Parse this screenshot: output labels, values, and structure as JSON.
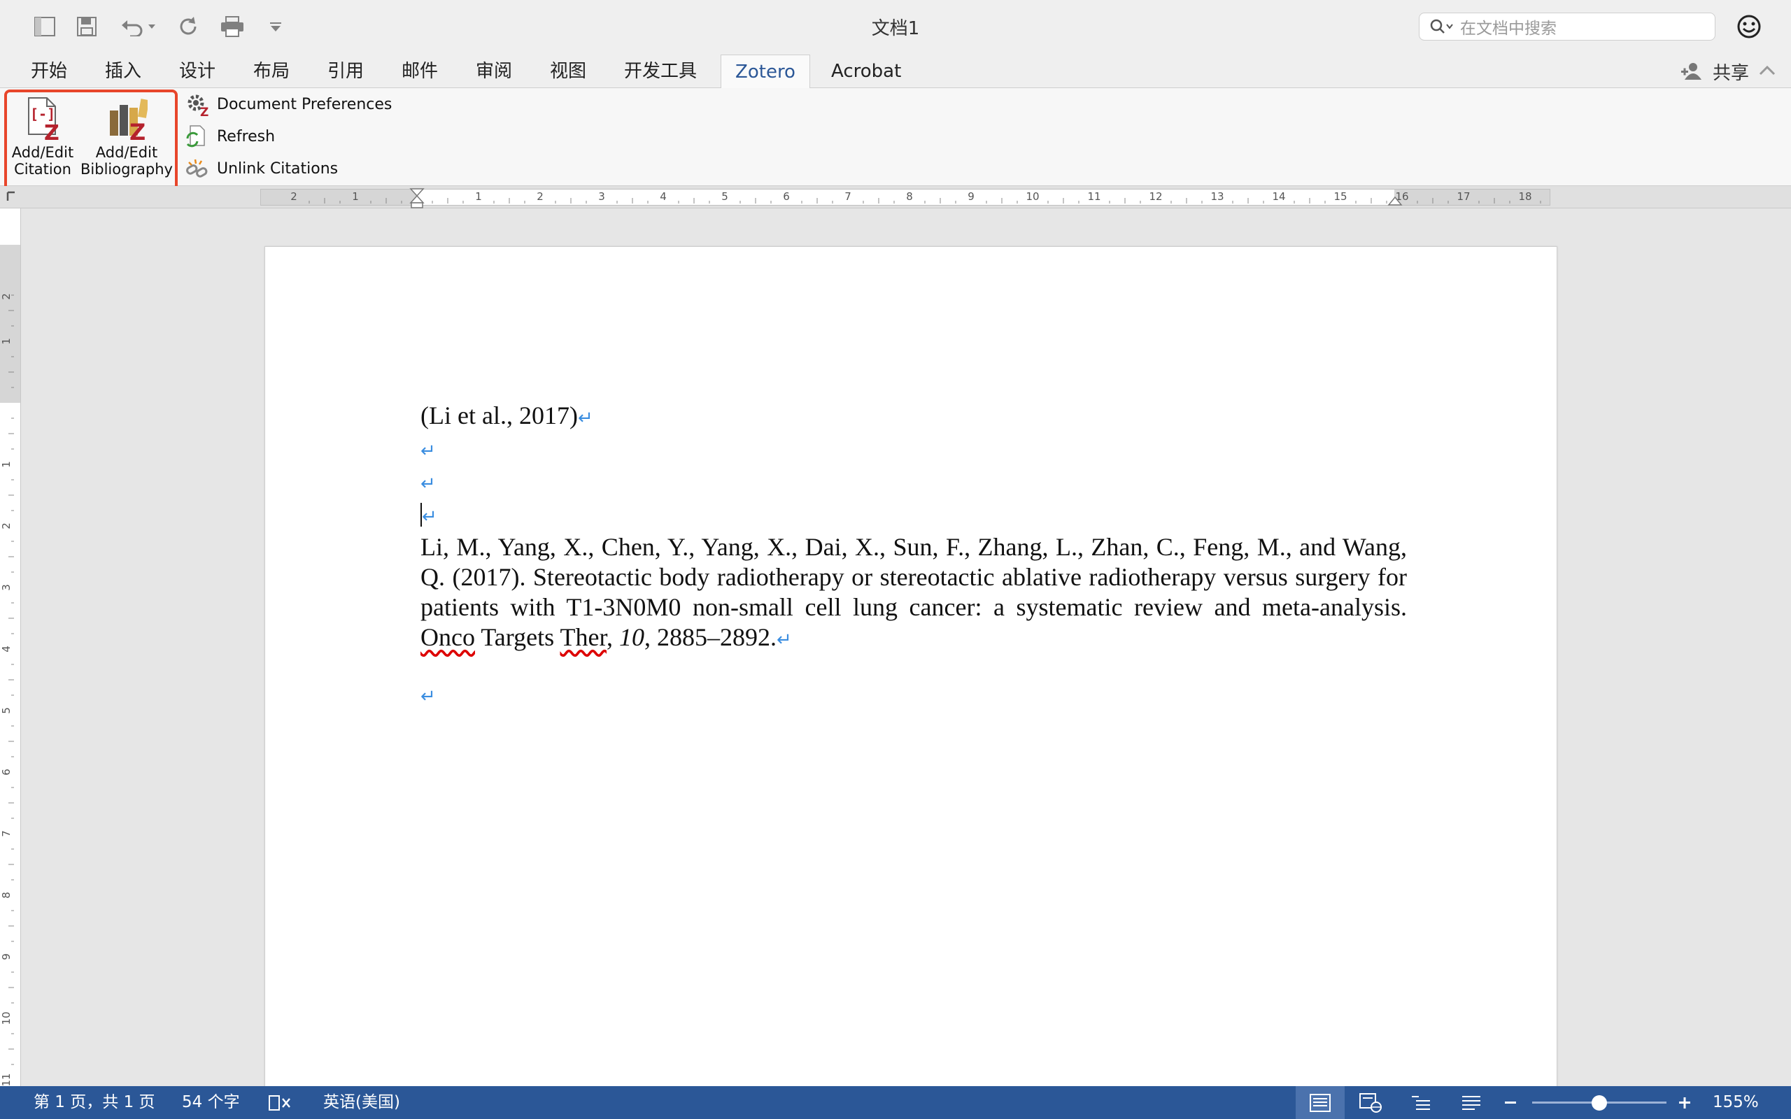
{
  "window": {
    "title": "文档1"
  },
  "quick_access": {
    "icons": [
      "sidebar-icon",
      "save-icon",
      "undo-icon",
      "redo-icon",
      "print-icon",
      "customize-icon"
    ]
  },
  "search": {
    "placeholder": "在文档中搜索"
  },
  "tabs": [
    {
      "label": "开始"
    },
    {
      "label": "插入"
    },
    {
      "label": "设计"
    },
    {
      "label": "布局"
    },
    {
      "label": "引用"
    },
    {
      "label": "邮件"
    },
    {
      "label": "审阅"
    },
    {
      "label": "视图"
    },
    {
      "label": "开发工具"
    },
    {
      "label": "Zotero",
      "active": true
    },
    {
      "label": "Acrobat"
    }
  ],
  "share": {
    "label": "共享"
  },
  "ribbon": {
    "add_citation": {
      "line1": "Add/Edit",
      "line2": "Citation"
    },
    "add_bibliography": {
      "line1": "Add/Edit",
      "line2": "Bibliography"
    },
    "doc_prefs": "Document Preferences",
    "refresh": "Refresh",
    "unlink": "Unlink Citations"
  },
  "ruler": {
    "h_labels": [
      "2",
      "1",
      "1",
      "2",
      "3",
      "4",
      "5",
      "6",
      "7",
      "8",
      "9",
      "10",
      "11",
      "12",
      "13",
      "14",
      "15",
      "16",
      "17",
      "18"
    ],
    "v_labels": [
      "2",
      "1",
      "1",
      "2",
      "3",
      "4",
      "5",
      "6",
      "7",
      "8",
      "9",
      "10",
      "11"
    ]
  },
  "document": {
    "citation": "(Li et al., 2017)",
    "bib_prefix": "Li, M., Yang, X., Chen, Y., Yang, X., Dai, X., Sun, F., Zhang, L., Zhan, C., Feng, M., and Wang, Q. (2017). Stereotactic body radiotherapy or stereotactic ablative radiotherapy versus surgery for patients with T1-3N0M0 non-small cell lung cancer: a systematic review and meta-analysis. ",
    "journal_w1": "Onco",
    "journal_w2": " Targets ",
    "journal_w3": "Ther",
    "volume": "10",
    "pages": ", 2885–2892.",
    "paragraph_mark": "↵"
  },
  "status": {
    "page": "第 1 页，共 1 页",
    "words": "54 个字",
    "language": "英语(美国)",
    "zoom": "155%",
    "zoom_fraction": 0.5
  },
  "colors": {
    "accent": "#2b5797",
    "highlight": "#e8462b",
    "zotero_red": "#b5222d"
  }
}
